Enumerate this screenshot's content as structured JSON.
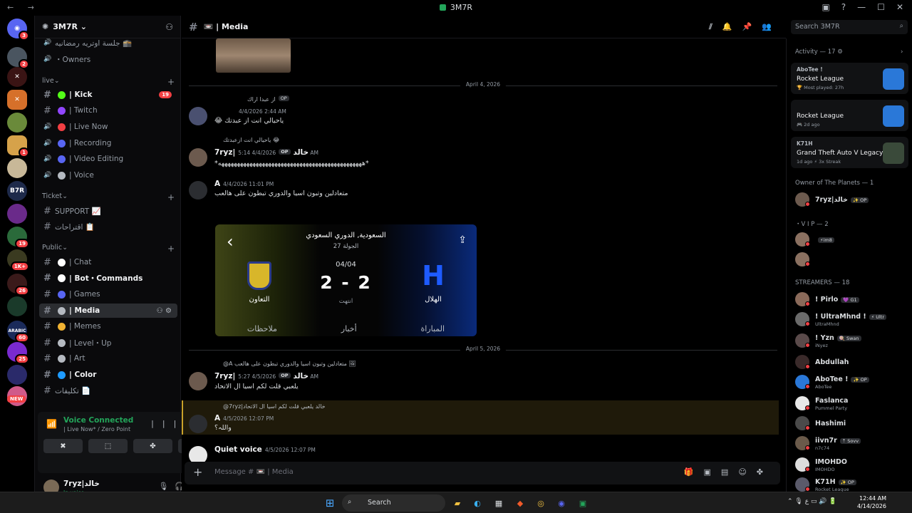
{
  "window": {
    "title": "3M7R",
    "nav": "← →",
    "controls": [
      "▣",
      "?",
      "—",
      "☐",
      "✕"
    ]
  },
  "rail": {
    "new_label": "NEW",
    "servers": [
      {
        "name": "discord-home",
        "label": "◉",
        "color": "#5865f2",
        "badge": "3"
      },
      {
        "name": "server-2",
        "label": "",
        "color": "#4a5560",
        "badge": "2"
      },
      {
        "name": "server-3",
        "label": "✕",
        "color": "#3a1414",
        "badge": ""
      },
      {
        "name": "server-4",
        "label": "✕",
        "color": "#d6702a",
        "badge": ""
      },
      {
        "name": "server-5",
        "label": "",
        "color": "#6a8a3a",
        "badge": ""
      },
      {
        "name": "server-6",
        "label": "",
        "color": "#d6a24a",
        "badge": "1"
      },
      {
        "name": "server-7",
        "label": "",
        "color": "#c8b898",
        "badge": ""
      },
      {
        "name": "server-b7r",
        "label": "B7R",
        "color": "#1e2a4a",
        "badge": ""
      },
      {
        "name": "server-9",
        "label": "",
        "color": "#6a2a8a",
        "badge": ""
      },
      {
        "name": "server-10",
        "label": "",
        "color": "#2a6a3a",
        "badge": "19"
      },
      {
        "name": "server-11",
        "label": "",
        "color": "#3a3a20",
        "badge": "1K+"
      },
      {
        "name": "server-12",
        "label": "",
        "color": "#3a1a1a",
        "badge": "26"
      },
      {
        "name": "server-13",
        "label": "",
        "color": "#1a3a2a",
        "badge": ""
      },
      {
        "name": "server-arabic",
        "label": "ARABIC",
        "color": "#1a2a5a",
        "badge": "60"
      },
      {
        "name": "server-15",
        "label": "",
        "color": "#7a2ad0",
        "badge": "25"
      },
      {
        "name": "server-16",
        "label": "",
        "color": "#2a2a6a",
        "badge": ""
      },
      {
        "name": "server-17",
        "label": "",
        "color": "#d05a8a",
        "badge": ""
      }
    ]
  },
  "sidebar": {
    "server_name": "3M7R",
    "channels_top": [
      {
        "label": "جلسة اوتريه رمضانيه 🕋",
        "color": ""
      },
      {
        "label": "・Owners",
        "color": ""
      }
    ],
    "cat_live": "live",
    "live": [
      {
        "label": "| Kick",
        "color": "#53fc18",
        "bold": true,
        "count": "19"
      },
      {
        "label": "| Twitch",
        "color": "#9146ff",
        "bold": false,
        "count": ""
      },
      {
        "label": "| Live Now",
        "color": "#f23f43",
        "bold": false,
        "count": ""
      },
      {
        "label": "| Recording",
        "color": "#5865f2",
        "bold": false,
        "count": ""
      },
      {
        "label": "| Video Editing",
        "color": "#5865f2",
        "bold": false,
        "count": ""
      },
      {
        "label": "| Voice",
        "color": "#b5bac1",
        "bold": false,
        "count": ""
      }
    ],
    "cat_ticket": "Ticket",
    "ticket": [
      {
        "label": "SUPPORT 📈",
        "color": ""
      },
      {
        "label": "اقتراحات 📋",
        "color": ""
      }
    ],
    "cat_public": "Public",
    "public": [
      {
        "label": "| Chat",
        "color": "#ffffff",
        "bold": false
      },
      {
        "label": "| Bot・Commands",
        "color": "#ffffff",
        "bold": true
      },
      {
        "label": "| Games",
        "color": "#5865f2",
        "bold": false
      },
      {
        "label": "| Media",
        "color": "#b5bac1",
        "bold": true,
        "active": true
      },
      {
        "label": "| Memes",
        "color": "#f0b232",
        "bold": false
      },
      {
        "label": "| Level・Up",
        "color": "#b5bac1",
        "bold": false
      },
      {
        "label": "| Art",
        "color": "#b5bac1",
        "bold": false
      },
      {
        "label": "| Color",
        "color": "#1e9bff",
        "bold": true
      },
      {
        "label": "تكليفات 📄",
        "color": "",
        "bold": false
      }
    ],
    "voice": {
      "title": "Voice Connected",
      "sub": "| Live Now* / Zero Point",
      "buttons": [
        "✖",
        "⬚",
        "✤",
        "✺"
      ]
    },
    "user": {
      "name": "7ryz|خالد",
      "status": "In voice"
    }
  },
  "channel": {
    "title": "| Media",
    "composer_placeholder": "Message # 📼 | Media"
  },
  "search_placeholder": "Search 3M7R",
  "messages": {
    "date1": "April 4, 2026",
    "m1_reply": "از عبدا اراك",
    "m1_time": "4/4/2026 2:44 AM",
    "m1_text": "ياحيالي انت از عبدتك 😂",
    "m2_reply": "ياحيالي انت ازعبدتك 😂",
    "m2_author": "7ryz|خالد",
    "m2_time": "4/4/2026 5:14 AM",
    "m2_text": "*ههههههههههههههههههههههههههههههههههههههههههههههه*",
    "m3_author": "A",
    "m3_time": "4/4/2026 11:01 PM",
    "m3_text": "متعادلين وتبون اسيا والدوري تبطون على هالعب",
    "date2": "April 5, 2026",
    "m4_reply": "@A متعادلين وتبون اسيا والدوري تبطون على هالعب 🖼",
    "m4_author": "7ryz|خالد",
    "m4_time": "4/5/2026 5:27 AM",
    "m4_text": "يلعبي قلت لكم اسيا ال الاتحاد",
    "m5_reply": "@7ryz|خالد يلعبي قلت لكم اسيا ال الاتحاد",
    "m5_author": "A",
    "m5_time": "4/5/2026 12:07 PM",
    "m5_text": "واللہ؟",
    "m6_author": "Quiet voice",
    "m6_time": "4/5/2026 12:07 PM",
    "op_tag": "OP"
  },
  "match_card": {
    "league": "السعودية, الدوري السعودي",
    "round": "الجولة 27",
    "date": "04/04",
    "score": "2 - 2",
    "status": "انتهت",
    "team_home": "التعاون",
    "team_away": "الهلال",
    "tabs": [
      "ملاحظات",
      "أخبار",
      "المباراة"
    ]
  },
  "right_panel": {
    "activity_header": "Activity — 17 ⚙",
    "activities": [
      {
        "who": "AboTee !",
        "game": "Rocket League",
        "sub": "🏆 Most played: 27h",
        "color": "#2a78d8"
      },
      {
        "who": "",
        "game": "Rocket League",
        "sub": "🎮 2d ago",
        "color": "#2a78d8"
      },
      {
        "who": "K71H",
        "game": "Grand Theft Auto V Legacy",
        "sub": "1d ago  ⚡ 3x Streak",
        "color": "#3a4a3a"
      }
    ],
    "owner_header": "Owner of The Planets — 1",
    "vip_header": "・V I P — 2",
    "streamers_header": "STREAMERS — 18",
    "owner_member": {
      "name": "7ryz|خالد",
      "tag": "✨ OP"
    },
    "vip_members": [
      {
        "name": "",
        "tag": "⚡im8",
        "status": ""
      },
      {
        "name": "",
        "tag": "",
        "status": ""
      }
    ],
    "streamers": [
      {
        "name": "! Pirlo",
        "tag": "💜 G1",
        "status": ""
      },
      {
        "name": "! UltraMhnd !",
        "tag": "⚡ Ultr",
        "status": "UltraMhnd"
      },
      {
        "name": "! Yzn",
        "tag": "🍭 Swan",
        "status": "iNyez"
      },
      {
        "name": "Abdullah",
        "tag": "",
        "status": ""
      },
      {
        "name": "AboTee !",
        "tag": "✨ OP",
        "status": "AboTee"
      },
      {
        "name": "Faslanca",
        "tag": "",
        "status": "Pummel Party"
      },
      {
        "name": "Hashimi",
        "tag": "",
        "status": ""
      },
      {
        "name": "iivn7r",
        "tag": "⇡ Sovv",
        "status": "n7c74"
      },
      {
        "name": "IMOHDO",
        "tag": "",
        "status": "IMOHDO"
      },
      {
        "name": "K71H",
        "tag": "✨ OP",
        "status": "Rocket League"
      }
    ]
  },
  "taskbar": {
    "search": "Search",
    "time": "12:44 AM",
    "date": "4/14/2026"
  }
}
